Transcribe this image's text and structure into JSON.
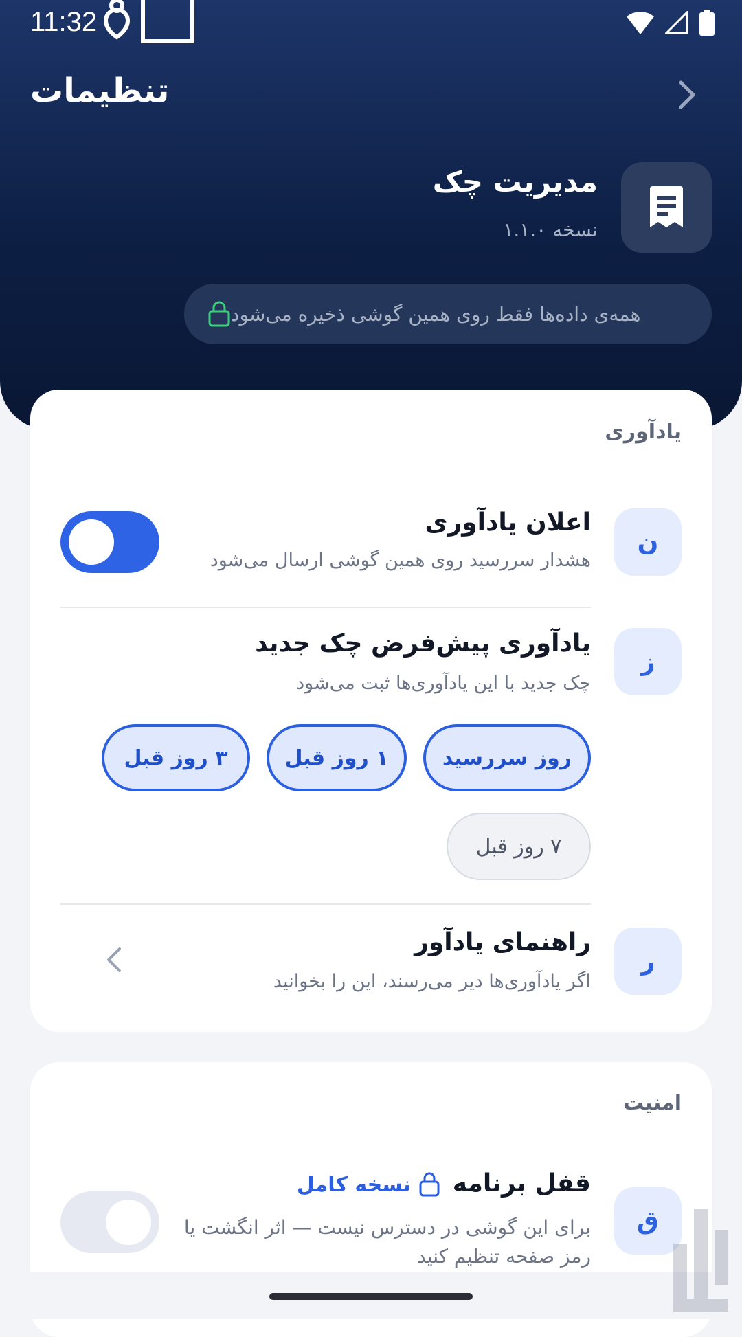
{
  "status_bar": {
    "time": "11:32"
  },
  "header": {
    "title": "تنظیمات",
    "app_name": "مدیریت چک",
    "version": "نسخه ۱.۱.۰",
    "privacy_note": "همه‌ی داده‌ها فقط روی همین گوشی ذخیره می‌شود"
  },
  "reminder_section": {
    "title": "یادآوری",
    "notification": {
      "icon_letter": "ن",
      "title": "اعلان یادآوری",
      "subtitle": "هشدار سررسید روی همین گوشی ارسال می‌شود",
      "enabled": true
    },
    "default_reminder": {
      "icon_letter": "ز",
      "title": "یادآوری پیش‌فرض چک جدید",
      "subtitle": "چک جدید با این یادآوری‌ها ثبت می‌شود",
      "chips": [
        {
          "label": "روز سررسید",
          "selected": true
        },
        {
          "label": "۱ روز قبل",
          "selected": true
        },
        {
          "label": "۳ روز قبل",
          "selected": true
        },
        {
          "label": "۷ روز قبل",
          "selected": false
        }
      ]
    },
    "guide": {
      "icon_letter": "ر",
      "title": "راهنمای یادآور",
      "subtitle": "اگر یادآوری‌ها دیر می‌رسند، این را بخوانید"
    }
  },
  "security_section": {
    "title": "امنیت",
    "app_lock": {
      "icon_letter": "ق",
      "title": "قفل برنامه",
      "badge": "نسخه کامل",
      "subtitle": "برای این گوشی در دسترس نیست — اثر انگشت یا رمز صفحه تنظیم کنید",
      "enabled": false
    }
  },
  "colors": {
    "accent": "#2f63e6",
    "header_bg": "#0d1f44",
    "lock_green": "#3ccf7a"
  }
}
